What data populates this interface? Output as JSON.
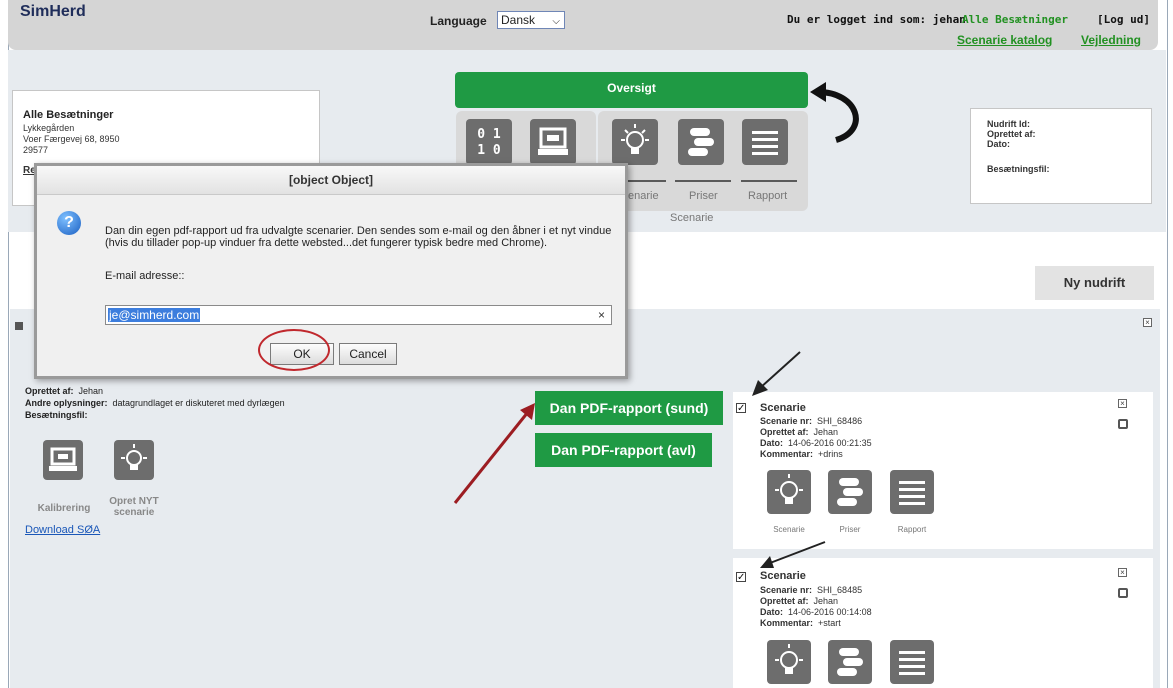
{
  "header": {
    "logo": "SimHerd",
    "language_label": "Language",
    "language_value": "Dansk",
    "logged_in_text": "Du er logget ind som: jehan",
    "alle_besaetninger": "Alle Besætninger",
    "log_ud": "[Log ud]",
    "scenarie_katalog": "Scenarie katalog",
    "vejledning": "Vejledning"
  },
  "herd_info": {
    "title": "Alle Besætninger",
    "farm": "Lykkegården",
    "address": "Voer Færgevej 68, 8950",
    "number": "29577",
    "link_fragment": "Re"
  },
  "nudrift_info": {
    "nudrift_id": "Nudrift Id:",
    "oprettet_af": "Oprettet af:",
    "dato": "Dato:",
    "besaetningsfil": "Besætningsfil:"
  },
  "workflow": {
    "oversigt": "Oversigt",
    "tabs": [
      "enarie",
      "Priser",
      "Rapport"
    ],
    "group_label": "Scenarie"
  },
  "ny_nudrift": "Ny nudrift",
  "nudrift_details": {
    "oprettet_af_label": "Oprettet af:",
    "oprettet_af_value": "Jehan",
    "andre_label": "Andre oplysninger:",
    "andre_value": "datagrundlaget er diskuteret med dyrlægen",
    "besaetningsfil_label": "Besætningsfil:",
    "kalibrering": "Kalibrering",
    "opret_nyt_line1": "Opret NYT",
    "opret_nyt_line2": "scenarie",
    "download": "Download SØA"
  },
  "pdf_buttons": {
    "sund": "Dan PDF-rapport (sund)",
    "avl": "Dan PDF-rapport (avl)"
  },
  "scenarios": [
    {
      "checked": "✓",
      "title": "Scenarie",
      "nr_label": "Scenarie nr:",
      "nr_value": "SHI_68486",
      "oprettet_label": "Oprettet af:",
      "oprettet_value": "Jehan",
      "dato_label": "Dato:",
      "dato_value": "14-06-2016 00:21:35",
      "kommentar_label": "Kommentar:",
      "kommentar_value": "+drins",
      "tile_labels": [
        "Scenarie",
        "Priser",
        "Rapport"
      ]
    },
    {
      "checked": "✓",
      "title": "Scenarie",
      "nr_label": "Scenarie nr:",
      "nr_value": "SHI_68485",
      "oprettet_label": "Oprettet af:",
      "oprettet_value": "Jehan",
      "dato_label": "Dato:",
      "dato_value": "14-06-2016 00:14:08",
      "kommentar_label": "Kommentar:",
      "kommentar_value": "+start"
    }
  ],
  "dialog": {
    "title": "[object Object]",
    "message": "Dan din egen pdf-rapport ud fra udvalgte scenarier. Den sendes som e-mail og den åbner i et nyt vindue (hvis du tillader pop-up vinduer fra dette websted...det fungerer typisk bedre med Chrome).",
    "email_label": "E-mail adresse::",
    "email_value": "je@simherd.com",
    "clear": "×",
    "ok": "OK",
    "cancel": "Cancel"
  },
  "icons": {
    "binary_tile_text": [
      "0 1",
      "1 0"
    ],
    "close_box": "×"
  },
  "colors": {
    "green": "#1f9a44",
    "link_green": "#229122",
    "annotation_red": "#c0282d"
  }
}
